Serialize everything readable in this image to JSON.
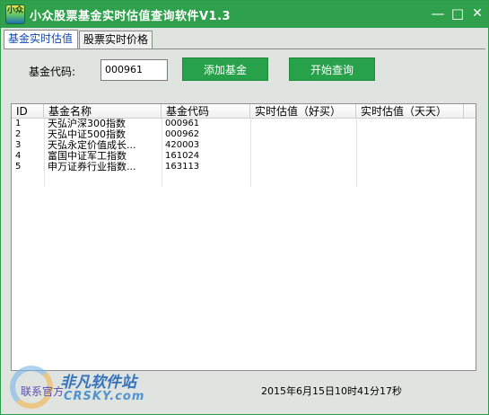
{
  "window": {
    "title": "小众股票基金实时估值查询软件V1.3",
    "icon_text": "小众",
    "controls": {
      "minimize": "—",
      "maximize": "□",
      "close": "✕"
    }
  },
  "tabs": [
    {
      "label": "基金实时估值",
      "active": true
    },
    {
      "label": "股票实时价格",
      "active": false
    }
  ],
  "form": {
    "code_label": "基金代码:",
    "code_value": "000961",
    "add_button": "添加基金",
    "query_button": "开始查询"
  },
  "list": {
    "columns": [
      "ID",
      "基金名称",
      "基金代码",
      "实时估值（好买）",
      "实时估值（天天）"
    ],
    "rows": [
      {
        "id": "1",
        "name": "天弘沪深300指数",
        "code": "000961",
        "good": "",
        "tian": ""
      },
      {
        "id": "2",
        "name": "天弘中证500指数",
        "code": "000962",
        "good": "",
        "tian": ""
      },
      {
        "id": "3",
        "name": "天弘永定价值成长...",
        "code": "420003",
        "good": "",
        "tian": ""
      },
      {
        "id": "4",
        "name": "富国中证军工指数",
        "code": "161024",
        "good": "",
        "tian": ""
      },
      {
        "id": "5",
        "name": "申万证券行业指数...",
        "code": "163113",
        "good": "",
        "tian": ""
      }
    ]
  },
  "footer": {
    "contact": "联系官方",
    "timestamp": "2015年6月15日10时41分17秒"
  },
  "watermark": {
    "brand": "非凡软件站",
    "url": "CRSKY.com"
  },
  "colors": {
    "titlebar": "#2fa14c",
    "button": "#27a24a",
    "active_tab_text": "#1148b0"
  }
}
